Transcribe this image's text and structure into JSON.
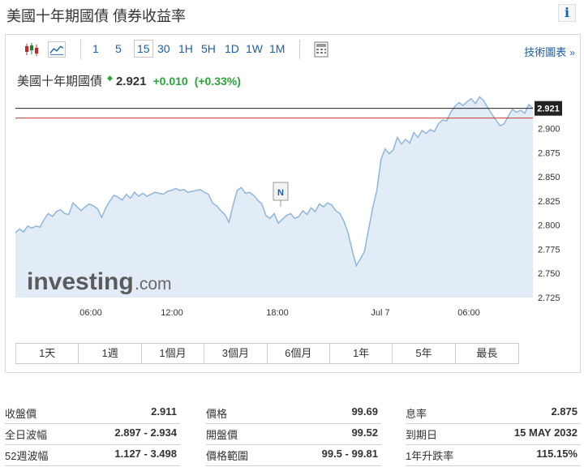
{
  "header": {
    "title": "美國十年期國債 債券收益率",
    "info_icon": "info-icon"
  },
  "toolbar": {
    "timeframes": [
      "1",
      "5",
      "15",
      "30",
      "1H",
      "5H",
      "1D",
      "1W",
      "1M"
    ],
    "active_timeframe": "15",
    "technical_chart_label": "技術圖表",
    "technical_chart_arrow": "»"
  },
  "quote": {
    "name": "美國十年期國債",
    "price": "2.921",
    "change": "+0.010",
    "change_pct": "(+0.33%)",
    "direction_icon": "up-arrow-icon",
    "color_up": "#2aa43b"
  },
  "chart_data": {
    "type": "area",
    "x_tick_labels": [
      "06:00",
      "12:00",
      "18:00",
      "Jul 7",
      "06:00"
    ],
    "y_tick_labels": [
      "2.900",
      "2.875",
      "2.850",
      "2.825",
      "2.800",
      "2.775",
      "2.750",
      "2.725"
    ],
    "ylim": [
      2.725,
      2.935
    ],
    "current_value_label": "2.921",
    "reference_line": 2.911,
    "marker_label": "N",
    "watermark": "investing",
    "watermark_suffix": ".com",
    "series": [
      {
        "values": [
          2.792,
          2.796,
          2.793,
          2.799,
          2.797,
          2.799,
          2.798,
          2.806,
          2.812,
          2.809,
          2.814,
          2.816,
          2.812,
          2.811,
          2.823,
          2.819,
          2.815,
          2.819,
          2.822,
          2.82,
          2.817,
          2.808,
          2.818,
          2.825,
          2.831,
          2.829,
          2.826,
          2.832,
          2.828,
          2.834,
          2.83,
          2.833,
          2.83,
          2.832,
          2.834,
          2.833,
          2.832,
          2.835,
          2.836,
          2.838,
          2.836,
          2.837,
          2.834,
          2.835,
          2.836,
          2.837,
          2.834,
          2.832,
          2.823,
          2.82,
          2.815,
          2.811,
          2.803,
          2.821,
          2.836,
          2.839,
          2.833,
          2.834,
          2.831,
          2.826,
          2.822,
          2.81,
          2.807,
          2.812,
          2.802,
          2.806,
          2.81,
          2.812,
          2.807,
          2.809,
          2.815,
          2.811,
          2.818,
          2.814,
          2.822,
          2.819,
          2.823,
          2.821,
          2.815,
          2.812,
          2.804,
          2.792,
          2.774,
          2.758,
          2.765,
          2.773,
          2.796,
          2.818,
          2.836,
          2.868,
          2.879,
          2.874,
          2.878,
          2.891,
          2.884,
          2.889,
          2.885,
          2.896,
          2.891,
          2.898,
          2.895,
          2.899,
          2.897,
          2.905,
          2.909,
          2.908,
          2.917,
          2.923,
          2.927,
          2.924,
          2.928,
          2.931,
          2.926,
          2.933,
          2.929,
          2.922,
          2.915,
          2.909,
          2.903,
          2.905,
          2.913,
          2.92,
          2.917,
          2.919,
          2.916,
          2.925,
          2.921
        ]
      }
    ]
  },
  "ranges": [
    "1天",
    "1週",
    "1個月",
    "3個月",
    "6個月",
    "1年",
    "5年",
    "最長"
  ],
  "stats": {
    "col1": [
      {
        "label": "收盤價",
        "value": "2.911"
      },
      {
        "label": "全日波幅",
        "value": "2.897 - 2.934"
      },
      {
        "label": "52週波幅",
        "value": "1.127 - 3.498"
      }
    ],
    "col2": [
      {
        "label": "價格",
        "value": "99.69"
      },
      {
        "label": "開盤價",
        "value": "99.52"
      },
      {
        "label": "價格範圍",
        "value": "99.5 - 99.81"
      }
    ],
    "col3": [
      {
        "label": "息率",
        "value": "2.875"
      },
      {
        "label": "到期日",
        "value": "15 MAY 2032"
      },
      {
        "label": "1年升跌率",
        "value": "115.15%"
      }
    ]
  }
}
